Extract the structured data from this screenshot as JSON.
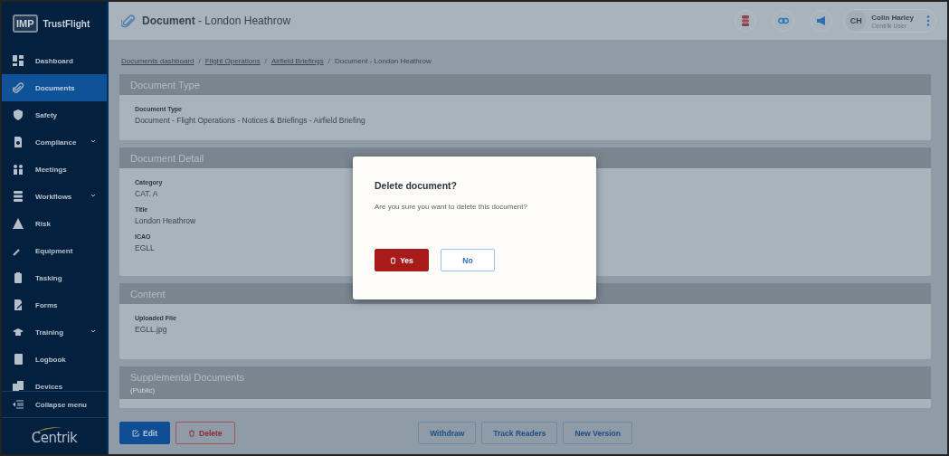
{
  "brand": {
    "logo": "IMP",
    "name": "TrustFlight"
  },
  "sidebar": {
    "items": [
      {
        "label": "Dashboard",
        "selected": false,
        "expandable": false
      },
      {
        "label": "Documents",
        "selected": true,
        "expandable": false
      },
      {
        "label": "Safety",
        "selected": false,
        "expandable": false
      },
      {
        "label": "Compliance",
        "selected": false,
        "expandable": true
      },
      {
        "label": "Meetings",
        "selected": false,
        "expandable": false
      },
      {
        "label": "Workflows",
        "selected": false,
        "expandable": true
      },
      {
        "label": "Risk",
        "selected": false,
        "expandable": false
      },
      {
        "label": "Equipment",
        "selected": false,
        "expandable": false
      },
      {
        "label": "Tasking",
        "selected": false,
        "expandable": false
      },
      {
        "label": "Forms",
        "selected": false,
        "expandable": false
      },
      {
        "label": "Training",
        "selected": false,
        "expandable": true
      },
      {
        "label": "Logbook",
        "selected": false,
        "expandable": false
      },
      {
        "label": "Devices",
        "selected": false,
        "expandable": false
      }
    ],
    "collapse": "Collapse menu",
    "footer_logo": "Centrik"
  },
  "header": {
    "title_kind": "Document",
    "title_separator": "-",
    "title_name": "London Heathrow",
    "user": {
      "initials": "CH",
      "name": "Colin Harley",
      "role": "Centrik User"
    }
  },
  "breadcrumb": {
    "separator": "/",
    "items": [
      {
        "label": "Documents dashboard",
        "link": true
      },
      {
        "label": "Flight Operations",
        "link": true
      },
      {
        "label": "Airfield Briefings",
        "link": true
      },
      {
        "label": "Document - London Heathrow",
        "link": false
      }
    ]
  },
  "sections": [
    {
      "title": "Document Type",
      "fields": [
        {
          "label": "Document Type",
          "value": "Document - Flight Operations - Notices & Briefings - Airfield Briefing"
        }
      ]
    },
    {
      "title": "Document Detail",
      "fields": [
        {
          "label": "Category",
          "value": "CAT. A"
        },
        {
          "label": "Title",
          "value": "London Heathrow"
        },
        {
          "label": "ICAO",
          "value": "EGLL"
        }
      ]
    },
    {
      "title": "Content",
      "fields": [
        {
          "label": "Uploaded File",
          "value": "EGLL.jpg"
        }
      ]
    },
    {
      "title": "Supplemental Documents",
      "subtitle": "(Public)"
    }
  ],
  "actions": {
    "left": [
      {
        "label": "Edit",
        "kind": "primary"
      },
      {
        "label": "Delete",
        "kind": "danger"
      }
    ],
    "right": [
      {
        "label": "Withdraw",
        "kind": "outline"
      },
      {
        "label": "Track Readers",
        "kind": "outline"
      },
      {
        "label": "New Version",
        "kind": "outline"
      }
    ]
  },
  "dialog": {
    "title": "Delete document?",
    "message": "Are you sure you want to delete this document?",
    "buttons": [
      {
        "label": "Yes",
        "kind": "danger"
      },
      {
        "label": "No",
        "kind": "outline"
      }
    ]
  }
}
